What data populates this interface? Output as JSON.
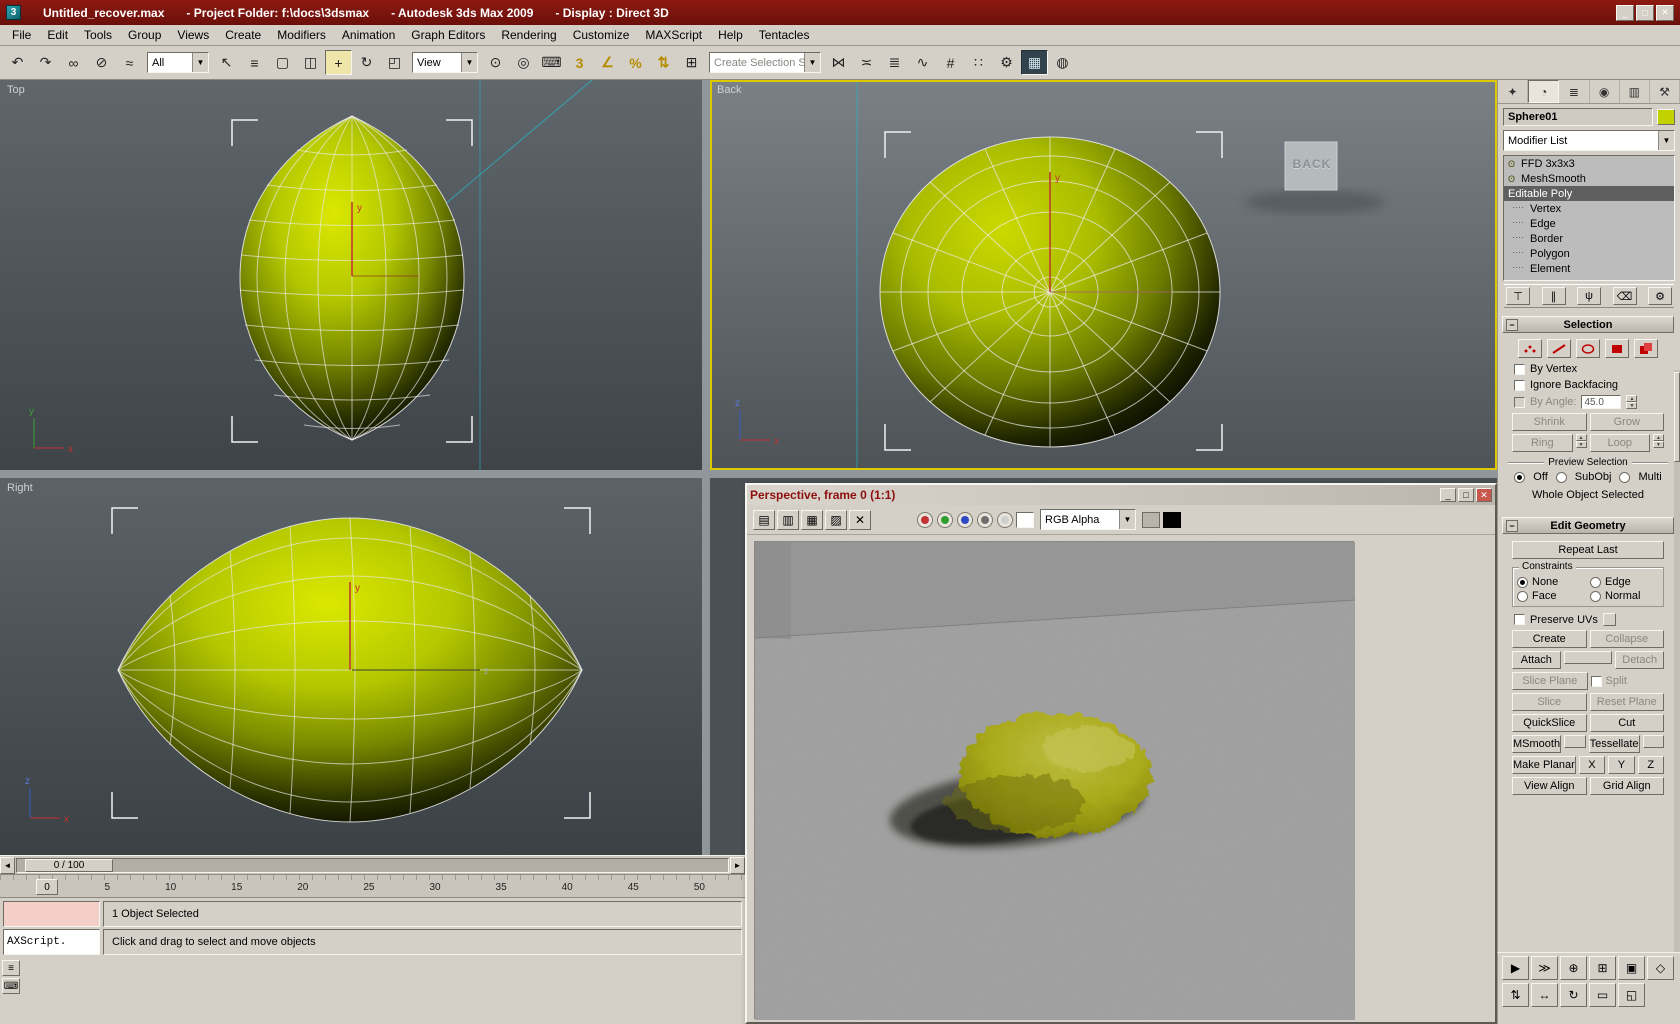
{
  "titlebar": {
    "segments": [
      "Untitled_recover.max",
      "- Project Folder: f:\\docs\\3dsmax",
      "- Autodesk 3ds Max  2009",
      "- Display : Direct 3D"
    ],
    "buttons": [
      {
        "name": "minimize-icon",
        "glyph": "_"
      },
      {
        "name": "maximize-icon",
        "glyph": "□"
      },
      {
        "name": "close-icon",
        "glyph": "✕"
      }
    ]
  },
  "menu": {
    "items": [
      {
        "label": "File"
      },
      {
        "label": "Edit"
      },
      {
        "label": "Tools"
      },
      {
        "label": "Group"
      },
      {
        "label": "Views"
      },
      {
        "label": "Create"
      },
      {
        "label": "Modifiers"
      },
      {
        "label": "Animation"
      },
      {
        "label": "Graph Editors"
      },
      {
        "label": "Rendering"
      },
      {
        "label": "Customize"
      },
      {
        "label": "MAXScript"
      },
      {
        "label": "Help"
      },
      {
        "label": "Tentacles"
      }
    ]
  },
  "toolbar": {
    "group1": [
      {
        "name": "undo-icon",
        "glyph": "↶"
      },
      {
        "name": "redo-icon",
        "glyph": "↷"
      },
      {
        "name": "select-and-link-icon",
        "glyph": "∞"
      },
      {
        "name": "unlink-selection-icon",
        "glyph": "⊘"
      },
      {
        "name": "bind-to-spacewarp-icon",
        "glyph": "≈"
      }
    ],
    "filter_value": "All",
    "group2": [
      {
        "name": "select-object-icon",
        "glyph": "↖"
      },
      {
        "name": "select-by-name-icon",
        "glyph": "≡"
      },
      {
        "name": "rectangular-selection-icon",
        "glyph": "▢"
      },
      {
        "name": "window-crossing-icon",
        "glyph": "◫"
      },
      {
        "name": "select-and-move-icon",
        "glyph": "+",
        "active": true
      },
      {
        "name": "select-and-rotate-icon",
        "glyph": "↻"
      },
      {
        "name": "select-and-scale-icon",
        "glyph": "◰"
      }
    ],
    "coord_value": "View",
    "group3": [
      {
        "name": "use-pivot-center-icon",
        "glyph": "⊙"
      },
      {
        "name": "select-and-manipulate-icon",
        "glyph": "◎"
      },
      {
        "name": "keyboard-override-icon",
        "glyph": "⌨"
      },
      {
        "name": "snaps-toggle-icon",
        "glyph": "3",
        "yellow": true
      },
      {
        "name": "angle-snap-icon",
        "glyph": "∠",
        "yellow": true
      },
      {
        "name": "percent-snap-icon",
        "glyph": "%",
        "yellow": true
      },
      {
        "name": "spinner-snap-icon",
        "glyph": "⇅",
        "yellow": true
      },
      {
        "name": "named-selection-sets-icon",
        "glyph": "⊞"
      }
    ],
    "selection_set_value": "Create Selection Set",
    "group4": [
      {
        "name": "mirror-icon",
        "glyph": "⋈"
      },
      {
        "name": "align-icon",
        "glyph": "≍"
      },
      {
        "name": "layer-manager-icon",
        "glyph": "≣"
      },
      {
        "name": "curve-editor-icon",
        "glyph": "∿"
      },
      {
        "name": "schematic-view-icon",
        "glyph": "#"
      },
      {
        "name": "material-editor-icon",
        "glyph": "∷"
      },
      {
        "name": "render-setup-icon",
        "glyph": "⚙"
      },
      {
        "name": "rendered-frame-icon",
        "glyph": "▦",
        "pressed": true
      },
      {
        "name": "render-production-icon",
        "glyph": "◍"
      }
    ]
  },
  "viewports": {
    "top": {
      "label": "Top"
    },
    "back": {
      "label": "Back",
      "cube_label": "BACK"
    },
    "right": {
      "label": "Right"
    }
  },
  "render_window": {
    "title": "Perspective, frame 0 (1:1)",
    "icons": [
      {
        "name": "save-image-icon",
        "glyph": "▤"
      },
      {
        "name": "copy-image-icon",
        "glyph": "▥"
      },
      {
        "name": "clone-window-icon",
        "glyph": "▦"
      },
      {
        "name": "print-image-icon",
        "glyph": "▨"
      },
      {
        "name": "clear-image-icon",
        "glyph": "✕"
      }
    ],
    "channels": [
      {
        "name": "red-channel-icon",
        "color": "#c43232"
      },
      {
        "name": "green-channel-icon",
        "color": "#2f9e2f"
      },
      {
        "name": "blue-channel-icon",
        "color": "#2f49c4"
      },
      {
        "name": "monochrome-channel-icon",
        "color": "#6e6e6e"
      },
      {
        "name": "alpha-channel-icon",
        "color": "#cfcfcf"
      }
    ],
    "channel_select": "RGB Alpha",
    "window_buttons": [
      {
        "name": "rfw-minimize-icon",
        "glyph": "_"
      },
      {
        "name": "rfw-maximize-icon",
        "glyph": "□"
      },
      {
        "name": "rfw-close-icon",
        "glyph": "✕",
        "close": true
      }
    ]
  },
  "command_panel": {
    "tabs": [
      {
        "name": "tab-create",
        "glyph": "✦"
      },
      {
        "name": "tab-modify",
        "glyph": "◔",
        "active": true
      },
      {
        "name": "tab-hierarchy",
        "glyph": "≣"
      },
      {
        "name": "tab-motion",
        "glyph": "◉"
      },
      {
        "name": "tab-display",
        "glyph": "▥"
      },
      {
        "name": "tab-utilities",
        "glyph": "⚒"
      }
    ],
    "object_name": "Sphere01",
    "object_color_style": "background:#c2d100",
    "modifier_list_label": "Modifier List",
    "stack_rows": [
      {
        "label": "FFD 3x3x3",
        "bulb": true
      },
      {
        "label": "MeshSmooth",
        "bulb": true
      },
      {
        "label": "Editable Poly",
        "selected": true
      },
      {
        "label": "Vertex",
        "indent": true
      },
      {
        "label": "Edge",
        "indent": true
      },
      {
        "label": "Border",
        "indent": true
      },
      {
        "label": "Polygon",
        "indent": true
      },
      {
        "label": "Element",
        "indent": true
      }
    ],
    "stack_tools": [
      {
        "name": "pin-stack-icon",
        "glyph": "⊤"
      },
      {
        "name": "show-end-result-icon",
        "glyph": "∥"
      },
      {
        "name": "make-unique-icon",
        "glyph": "ψ"
      },
      {
        "name": "remove-modifier-icon",
        "glyph": "⌫"
      },
      {
        "name": "configure-modifier-icon",
        "glyph": "⚙"
      }
    ],
    "selection": {
      "title": "Selection",
      "by_vertex": "By Vertex",
      "ignore_backfacing": "Ignore Backfacing",
      "by_angle": "By Angle:",
      "angle_value": "45.0",
      "shrink": "Shrink",
      "grow": "Grow",
      "ring": "Ring",
      "loop": "Loop",
      "preview_label": "Preview Selection",
      "off": "Off",
      "subobj": "SubObj",
      "multi": "Multi",
      "whole_object": "Whole Object Selected"
    },
    "edit_geometry": {
      "title": "Edit Geometry",
      "repeat_last": "Repeat Last",
      "constraints_label": "Constraints",
      "none": "None",
      "edge": "Edge",
      "face": "Face",
      "normal": "Normal",
      "preserve_uvs": "Preserve UVs",
      "create": "Create",
      "collapse": "Collapse",
      "attach": "Attach",
      "detach": "Detach",
      "slice_plane": "Slice Plane",
      "split": "Split",
      "slice": "Slice",
      "reset_plane": "Reset Plane",
      "quickslice": "QuickSlice",
      "cut": "Cut",
      "msmooth": "MSmooth",
      "tessellate": "Tessellate",
      "make_planar": "Make Planar",
      "x": "X",
      "y": "Y",
      "z": "Z",
      "view_align": "View Align",
      "grid_align": "Grid Align"
    }
  },
  "timeline": {
    "slider_label": "0 / 100",
    "current_frame": "0",
    "ticks": [
      "0",
      "5",
      "10",
      "15",
      "20",
      "25",
      "30",
      "35",
      "40",
      "45",
      "50"
    ]
  },
  "status_bar": {
    "selection_status": "1 Object Selected",
    "prompt": "Click and drag to select and move objects",
    "listener_text": "AXScript."
  },
  "nav_controls": {
    "row1": [
      {
        "name": "play-animation-icon",
        "glyph": "▶"
      },
      {
        "name": "go-to-end-icon",
        "glyph": "≫"
      },
      {
        "name": "zoom-icon",
        "glyph": "⊕"
      },
      {
        "name": "zoom-all-icon",
        "glyph": "⊞"
      },
      {
        "name": "zoom-extents-icon",
        "glyph": "▣"
      },
      {
        "name": "field-of-view-icon",
        "glyph": "◇"
      }
    ],
    "row2": [
      {
        "name": "key-step-icon",
        "glyph": "⇅"
      },
      {
        "name": "pan-icon",
        "glyph": "↔"
      },
      {
        "name": "arc-rotate-icon",
        "glyph": "↻"
      },
      {
        "name": "zoom-region-icon",
        "glyph": "▭"
      },
      {
        "name": "min-max-toggle-icon",
        "glyph": "◱"
      }
    ],
    "mini": [
      {
        "name": "listener-toggle-icon",
        "glyph": "≡"
      },
      {
        "name": "keyboard-icon",
        "glyph": "⌨"
      }
    ]
  }
}
